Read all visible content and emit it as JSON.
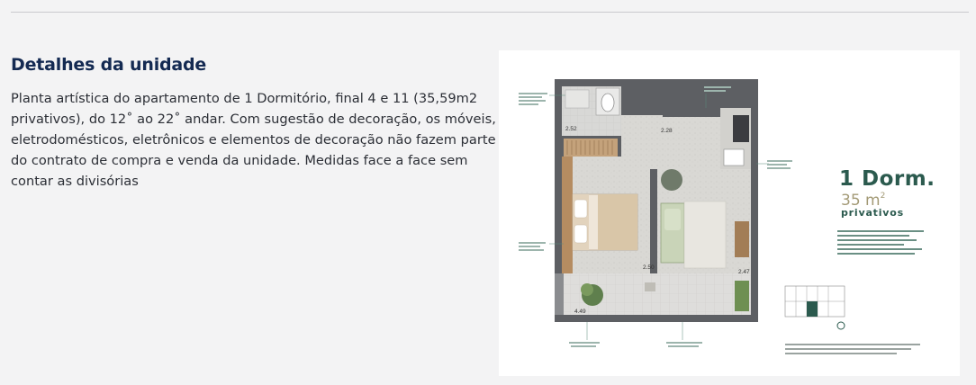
{
  "section": {
    "title": "Detalhes da unidade",
    "description": "Planta artística do apartamento de 1 Dormitório, final 4 e 11 (35,59m2 privativos), do 12˚ ao 22˚ andar. Com sugestão de decoração, os móveis, eletrodomésticos, eletrônicos e elementos de decoração não fazem parte do contrato de compra e venda da unidade. Medidas face a face sem contar as divisórias"
  },
  "floorplan": {
    "brand_title": "1 Dorm.",
    "brand_area_value": "35 m",
    "brand_area_unit": "2",
    "brand_subtitle": "privativos",
    "dimensions": {
      "bath": "2.52",
      "hall": "2.28",
      "bedroom": "2.50",
      "living": "2.47",
      "balcony": "4.49"
    },
    "colors": {
      "wall": "#5d5f63",
      "floor_light": "#dcdcd9",
      "wood": "#b58c61",
      "accent_green": "#2b5a4e",
      "accent_gold": "#a39a76"
    }
  }
}
